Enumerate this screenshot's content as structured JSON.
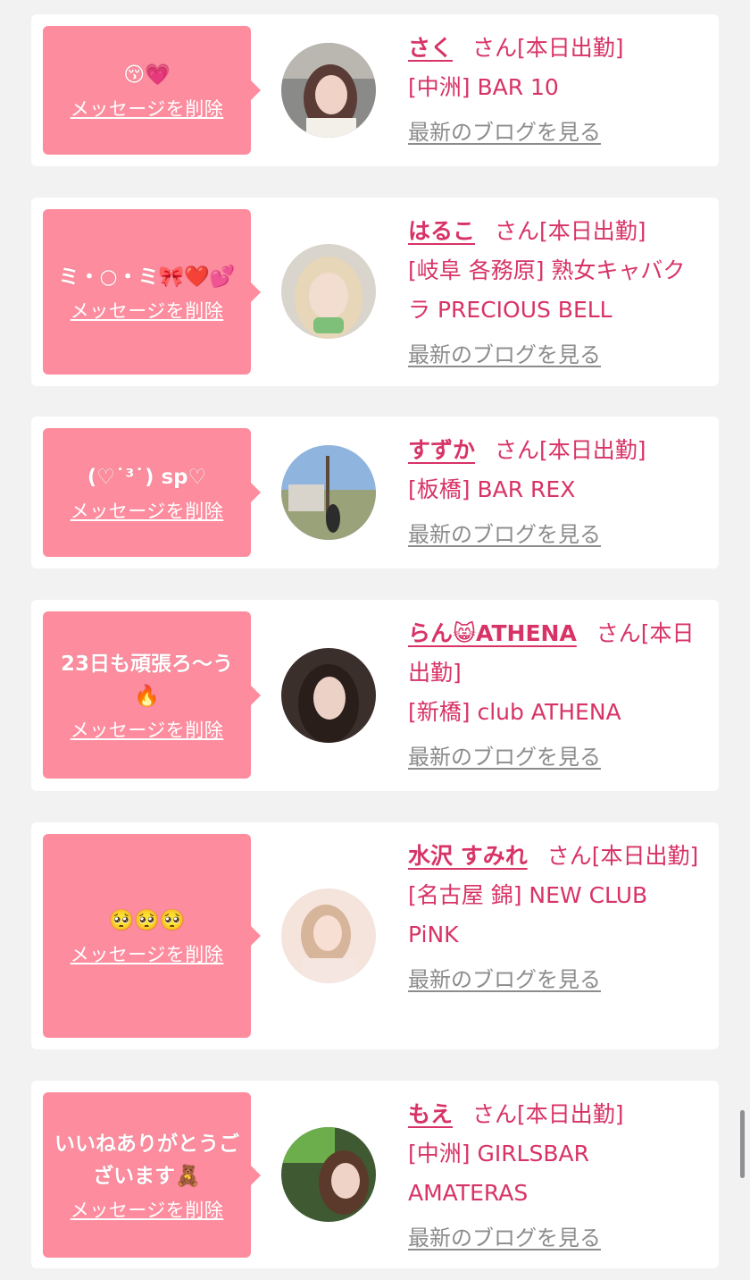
{
  "common": {
    "delete_label": "メッセージを削除",
    "blog_label": "最新のブログを見る",
    "san_label": "さん[本日出勤]"
  },
  "colors": {
    "bubble": "#fd8c9e",
    "name": "#d83366",
    "blog_link": "#8c8c8c",
    "background": "#f2f2f2"
  },
  "messages": [
    {
      "message": "😚💗",
      "name": "さく",
      "suffix": "さん[本日出勤]",
      "shop": "[中洲] BAR 10"
    },
    {
      "message": "ミ・○・ミ🎀❤️💕",
      "name": "はるこ",
      "suffix": "さん[本日出勤]",
      "shop": "[岐阜 各務原] 熟女キャバクラ PRECIOUS BELL"
    },
    {
      "message": "(♡˙³˙) sp♡",
      "name": "すずか",
      "suffix": "さん[本日出勤]",
      "shop": "[板橋] BAR REX"
    },
    {
      "message": "23日も頑張ろ〜う🔥",
      "name": "らん😸ATHENA",
      "suffix": "さん[本日出勤]",
      "shop": "[新橋] club ATHENA"
    },
    {
      "message": "🥺🥺🥺",
      "name": "水沢 すみれ",
      "suffix": "さん[本日出勤]",
      "shop": "[名古屋 錦] NEW CLUB PiNK"
    },
    {
      "message": "いいねありがとうございます🧸",
      "name": "もえ",
      "suffix": "さん[本日出勤]",
      "shop": "[中洲] GIRLSBAR AMATERAS"
    }
  ]
}
